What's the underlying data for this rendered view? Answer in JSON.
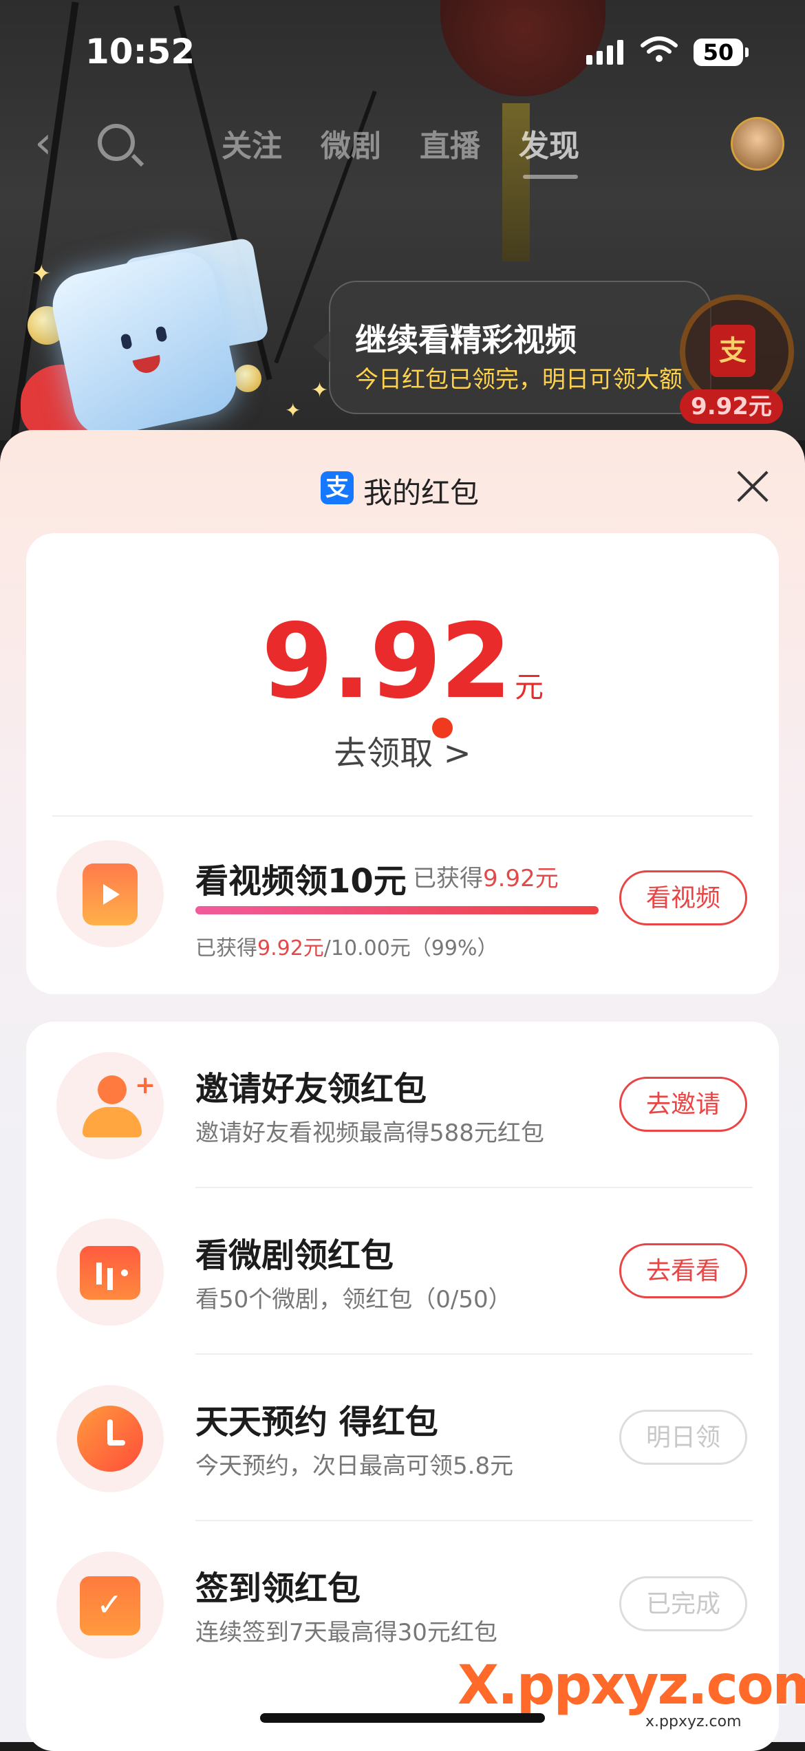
{
  "status": {
    "time": "10:52",
    "battery": "50"
  },
  "nav": {
    "tabs": [
      "关注",
      "微剧",
      "直播",
      "发现"
    ],
    "active_tab": "发现"
  },
  "bubble": {
    "title": "继续看精彩视频",
    "subtitle": "今日红包已领完，明日可领大额"
  },
  "float_badge": {
    "icon_char": "支",
    "amount": "9.92元"
  },
  "sheet": {
    "title": "我的红包",
    "logo_char": "支"
  },
  "balance": {
    "amount": "9.92",
    "unit": "元",
    "claim_label": "去领取",
    "claim_arrow": ">"
  },
  "video_task": {
    "title": "看视频领10元",
    "earned_prefix": "已获得",
    "earned_value": "9.92元",
    "progress_prefix": "已获得",
    "progress_value": "9.92元",
    "progress_suffix": "/10.00元（99%）",
    "progress_fraction": 0.99,
    "button": "看视频"
  },
  "tasks": [
    {
      "title": "邀请好友领红包",
      "subtitle": "邀请好友看视频最高得588元红包",
      "button": "去邀请",
      "icon": "invite-friend-icon",
      "enabled": true
    },
    {
      "title": "看微剧领红包",
      "subtitle": "看50个微剧，领红包（0/50）",
      "button": "去看看",
      "icon": "tv-icon",
      "enabled": true
    },
    {
      "title": "天天预约 得红包",
      "subtitle": "今天预约，次日最高可领5.8元",
      "button": "明日领",
      "icon": "clock-icon",
      "enabled": false
    },
    {
      "title": "签到领红包",
      "subtitle": "连续签到7天最高得30元红包",
      "button": "已完成",
      "icon": "calendar-check-icon",
      "enabled": false
    }
  ],
  "watermark": {
    "main": "X.ppxyz.com",
    "small": "x.ppxyz.com"
  },
  "colors": {
    "accent": "#e94545",
    "amount": "#ea2b2b",
    "alipay": "#1677ff"
  }
}
